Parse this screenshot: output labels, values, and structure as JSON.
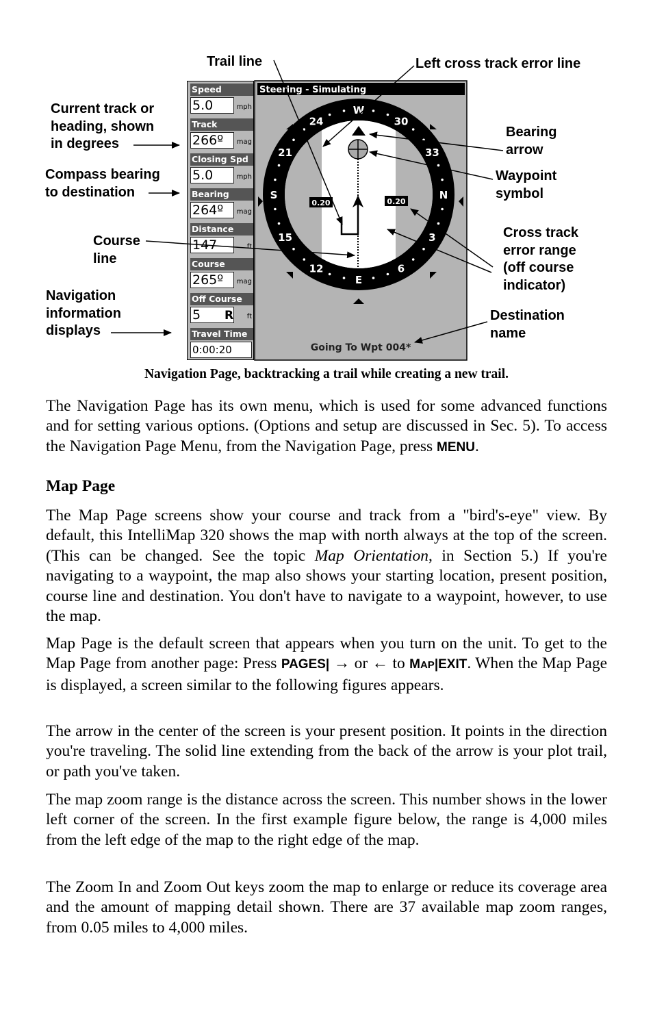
{
  "figure": {
    "callouts": {
      "trail_line": [
        "Trail line"
      ],
      "left_xte": [
        "Left cross track error line"
      ],
      "current_track": [
        "Current track or",
        "heading, shown",
        "in degrees"
      ],
      "compass_bearing": [
        "Compass bearing",
        "to destination"
      ],
      "course_line": [
        "Course",
        "line"
      ],
      "nav_displays": [
        "Navigation",
        "information",
        "displays"
      ],
      "bearing_arrow": [
        "Bearing",
        "arrow"
      ],
      "waypoint_symbol": [
        "Waypoint",
        "symbol"
      ],
      "xte_range": [
        "Cross track",
        "error range",
        "(off course",
        "indicator)"
      ],
      "destination_name": [
        "Destination",
        "name"
      ]
    },
    "screen": {
      "title": "Steering - Simulating",
      "fields": [
        {
          "label": "Speed",
          "value": "5.0",
          "unit": "mph"
        },
        {
          "label": "Track",
          "value": "266º",
          "unit": "mag"
        },
        {
          "label": "Closing Spd",
          "value": "5.0",
          "unit": "mph"
        },
        {
          "label": "Bearing",
          "value": "264º",
          "unit": "mag"
        },
        {
          "label": "Distance",
          "value": "147",
          "unit": "ft"
        },
        {
          "label": "Course",
          "value": "265º",
          "unit": "mag"
        },
        {
          "label": "Off Course",
          "value": "5",
          "side": "R",
          "unit": "ft"
        },
        {
          "label": "Travel Time",
          "value": "0:00:20"
        }
      ],
      "compass_labels": [
        "W",
        "30",
        "33",
        "N",
        "3",
        "6",
        "E",
        "12",
        "15",
        "S",
        "21",
        "24"
      ],
      "xte_left": "0.20",
      "xte_right": "0.20",
      "going_to": "Going To Wpt 004*",
      "colors": {
        "background": "#b4b4b4",
        "ring": "#000000",
        "lane": "#ffffff",
        "header": "#555555"
      }
    },
    "caption": "Navigation Page, backtracking a trail while creating a new trail."
  },
  "body": {
    "p1": {
      "text": "The Navigation Page has its own menu, which is used for some advanced functions and for setting various options. (Options and setup are discussed in Sec. 5). To access the Navigation Page Menu, from the Navigation Page, press ",
      "key": "MENU",
      "end": "."
    },
    "heading": "Map Page",
    "p2": {
      "a": "The Map Page screens show your course and track from a \"bird's-eye\" view. By default, this IntelliMap 320 shows the map with north always at the top of the screen. (This can be changed. See the topic ",
      "italic": "Map Orientation",
      "b": ", in Section 5.) If you're navigating to a waypoint, the map also shows your starting location, present position, course line and destination. You don't have to navigate to a waypoint, however, to use the map."
    },
    "p3": {
      "a": "Map Page is the default screen that appears when you turn on the unit. To get to the Map Page from another page: Press ",
      "key1": "PAGES|",
      "b": " → or ← to ",
      "key2_m": "M",
      "key2_ap": "AP",
      "key2_rest": "|EXIT",
      "c": ". When the Map Page is displayed, a screen similar to the following figures appears."
    },
    "p4": "The arrow in the center of the screen is your present position. It points in the direction you're traveling. The solid line extending from the back of the arrow is your plot trail, or path you've taken.",
    "p5": "The map zoom range is the distance across the screen. This number shows in the lower left corner of the screen. In the first example figure below, the range is 4,000 miles from the left edge of the map to the right edge of the map.",
    "p6": "The Zoom In and Zoom Out keys zoom the map to enlarge or reduce its coverage area and the amount of mapping detail shown. There are 37 available map zoom ranges, from 0.05 miles to 4,000 miles."
  }
}
